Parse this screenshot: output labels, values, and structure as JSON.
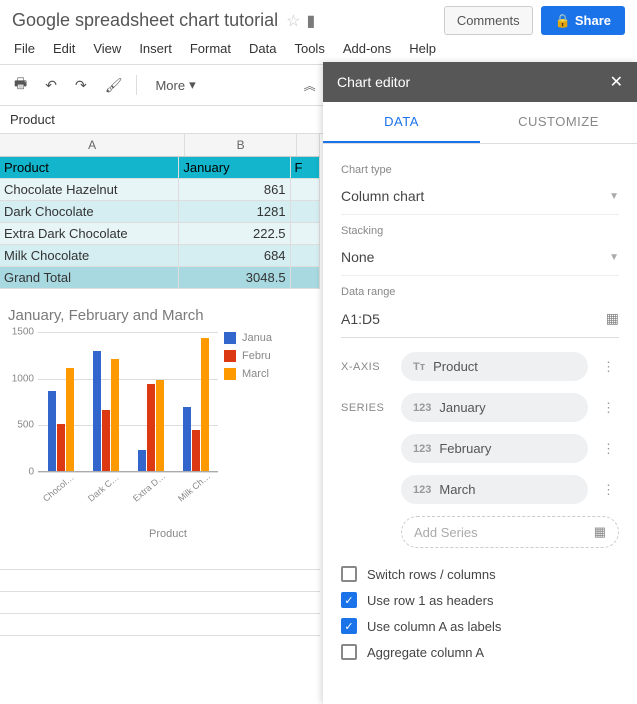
{
  "doc": {
    "title": "Google spreadsheet chart tutorial"
  },
  "buttons": {
    "comments": "Comments",
    "share": "Share"
  },
  "menu": [
    "File",
    "Edit",
    "View",
    "Insert",
    "Format",
    "Data",
    "Tools",
    "Add-ons",
    "Help"
  ],
  "toolbar": {
    "more": "More"
  },
  "formula_bar": "Product",
  "columns": [
    "A",
    "B"
  ],
  "colC_partial": "F",
  "table": {
    "header": [
      "Product",
      "January"
    ],
    "rows": [
      [
        "Chocolate Hazelnut",
        "861"
      ],
      [
        "Dark Chocolate",
        "1281"
      ],
      [
        "Extra Dark Chocolate",
        "222.5"
      ],
      [
        "Milk Chocolate",
        "684"
      ]
    ],
    "total": [
      "Grand Total",
      "3048.5"
    ]
  },
  "chart_data": {
    "type": "bar",
    "title": "January, February and March",
    "xlabel": "Product",
    "ylabel": "",
    "ylim": [
      0,
      1500
    ],
    "yticks": [
      0,
      500,
      1000,
      1500
    ],
    "categories": [
      "Chocolate Hazelnut",
      "Dark Chocolate",
      "Extra Dark Chocolate",
      "Milk Chocolate"
    ],
    "xlabels_short": [
      "Chocolate...",
      "Dark Choc...",
      "Extra Dark...",
      "Milk Choc..."
    ],
    "series": [
      {
        "name": "January",
        "legend_short": "Janua",
        "color": "#3366cc",
        "values": [
          861,
          1281,
          222.5,
          684
        ]
      },
      {
        "name": "February",
        "legend_short": "Febru",
        "color": "#dc3912",
        "values": [
          500,
          650,
          930,
          440
        ]
      },
      {
        "name": "March",
        "legend_short": "Marcl",
        "color": "#ff9900",
        "values": [
          1100,
          1200,
          980,
          1420
        ]
      }
    ]
  },
  "editor": {
    "title": "Chart editor",
    "tabs": {
      "data": "DATA",
      "customize": "CUSTOMIZE"
    },
    "chart_type_label": "Chart type",
    "chart_type_value": "Column chart",
    "stacking_label": "Stacking",
    "stacking_value": "None",
    "range_label": "Data range",
    "range_value": "A1:D5",
    "xaxis_label": "X-AXIS",
    "xaxis_value": "Product",
    "series_label": "SERIES",
    "series": [
      "January",
      "February",
      "March"
    ],
    "add_series": "Add Series",
    "checks": {
      "switch": {
        "label": "Switch rows / columns",
        "checked": false
      },
      "row1": {
        "label": "Use row 1 as headers",
        "checked": true
      },
      "colA": {
        "label": "Use column A as labels",
        "checked": true
      },
      "agg": {
        "label": "Aggregate column A",
        "checked": false
      }
    }
  }
}
